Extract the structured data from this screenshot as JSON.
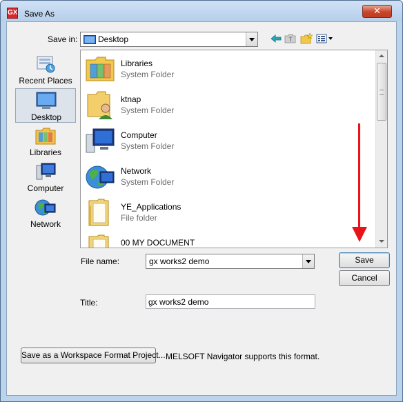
{
  "window": {
    "title": "Save As",
    "close_symbol": "✕",
    "app_icon": "app-icon",
    "app_icon_glyph": "GX"
  },
  "toolbar": {
    "save_in_label": "Save in:",
    "save_in_value": "Desktop",
    "icons": [
      "back-icon",
      "up-folder-icon",
      "new-folder-icon",
      "view-menu-icon"
    ]
  },
  "places": [
    {
      "label": "Recent Places",
      "icon": "recent-places-icon",
      "selected": false
    },
    {
      "label": "Desktop",
      "icon": "desktop-icon",
      "selected": true
    },
    {
      "label": "Libraries",
      "icon": "libraries-icon",
      "selected": false
    },
    {
      "label": "Computer",
      "icon": "computer-icon",
      "selected": false
    },
    {
      "label": "Network",
      "icon": "network-icon",
      "selected": false
    }
  ],
  "files": [
    {
      "name": "Libraries",
      "type": "System Folder",
      "icon": "libraries-folder-icon"
    },
    {
      "name": "ktnap",
      "type": "System Folder",
      "icon": "user-folder-icon"
    },
    {
      "name": "Computer",
      "type": "System Folder",
      "icon": "computer-icon"
    },
    {
      "name": "Network",
      "type": "System Folder",
      "icon": "network-icon"
    },
    {
      "name": "YE_Applications",
      "type": "File folder",
      "icon": "folder-icon"
    },
    {
      "name": "00 MY DOCUMENT",
      "type": "",
      "icon": "folder-icon"
    }
  ],
  "form": {
    "file_name_label": "File name:",
    "file_name_value": "gx works2 demo",
    "title_label": "Title:",
    "title_value": "gx works2 demo"
  },
  "buttons": {
    "save": "Save",
    "cancel": "Cancel",
    "workspace": "Save as a Workspace Format Project...",
    "workspace_note": "MELSOFT Navigator supports this format."
  },
  "colors": {
    "annotation_arrow": "#e8141a",
    "close_button": "#c7462a"
  }
}
